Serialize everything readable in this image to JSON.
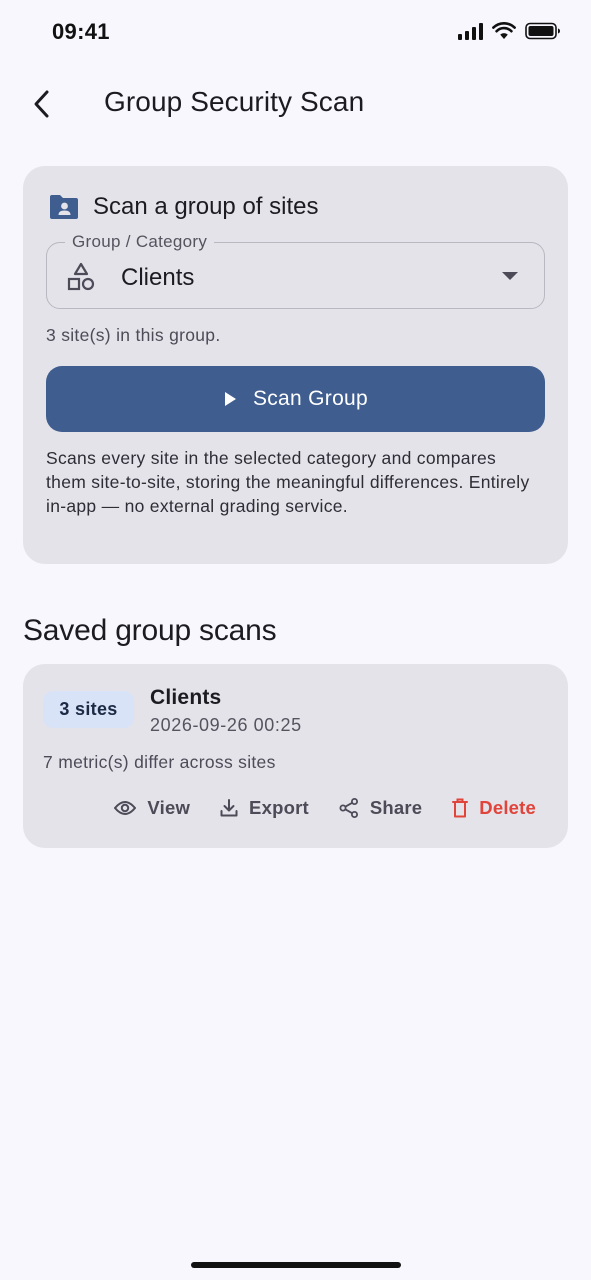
{
  "status_bar": {
    "time": "09:41"
  },
  "app_bar": {
    "title": "Group Security Scan"
  },
  "scan_card": {
    "title": "Scan a group of sites",
    "select_label": "Group / Category",
    "selected_group": "Clients",
    "count_text": "3 site(s) in this group.",
    "scan_button_label": "Scan Group",
    "description": "Scans every site in the selected category and compares them site-to-site, storing the meaningful differences. Entirely in-app — no external grading service."
  },
  "saved_section": {
    "title": "Saved group scans",
    "items": [
      {
        "badge": "3 sites",
        "name": "Clients",
        "date": "2026-09-26 00:25",
        "summary": "7 metric(s) differ across sites",
        "actions": {
          "view": "View",
          "export": "Export",
          "share": "Share",
          "delete": "Delete"
        }
      }
    ]
  },
  "colors": {
    "primary": "#3f5d8f",
    "danger": "#e0443b",
    "card": "#e4e3ea",
    "background": "#f8f7fd",
    "badge": "#d9e3f8"
  },
  "icons": [
    "back-arrow-icon",
    "folder-shared-icon",
    "category-icon",
    "dropdown-caret-icon",
    "play-icon",
    "eye-icon",
    "download-icon",
    "share-icon",
    "trash-icon"
  ]
}
